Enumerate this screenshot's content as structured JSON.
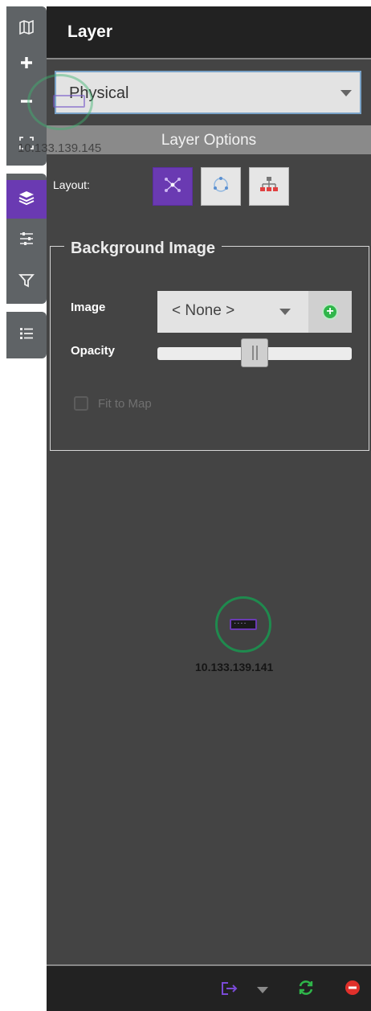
{
  "toolbar": {
    "top": [
      {
        "name": "map-icon",
        "glyph": "◫"
      },
      {
        "name": "zoom-in-icon",
        "glyph": "+"
      },
      {
        "name": "zoom-out-icon",
        "glyph": "−"
      },
      {
        "name": "fit-screen-icon",
        "glyph": "⛶"
      }
    ],
    "middle": [
      {
        "name": "layers-icon",
        "glyph": "≋",
        "active": true
      },
      {
        "name": "sliders-icon",
        "glyph": "☰"
      },
      {
        "name": "filter-icon",
        "glyph": "▽"
      }
    ],
    "bottom": [
      {
        "name": "list-icon",
        "glyph": "☷"
      }
    ]
  },
  "panel": {
    "title": "Layer",
    "layer_select": "Physical",
    "options_title": "Layer Options",
    "layout_label": "Layout:",
    "background": {
      "legend": "Background Image",
      "image_label": "Image",
      "image_value": "< None >",
      "opacity_label": "Opacity",
      "opacity_level": 0.5,
      "fit_label": "Fit to Map",
      "fit_checked": false
    }
  },
  "map": {
    "ghost_node_label": "10.133.139.145",
    "node_label": "10.133.139.141"
  },
  "colors": {
    "accent": "#6a3ab2",
    "panel_bg": "#444444",
    "header_bg": "#222222",
    "node_ring": "#1f8a4e",
    "add_green": "#2fb64a",
    "refresh_green": "#2fb64a",
    "stop_red": "#e0302b"
  }
}
